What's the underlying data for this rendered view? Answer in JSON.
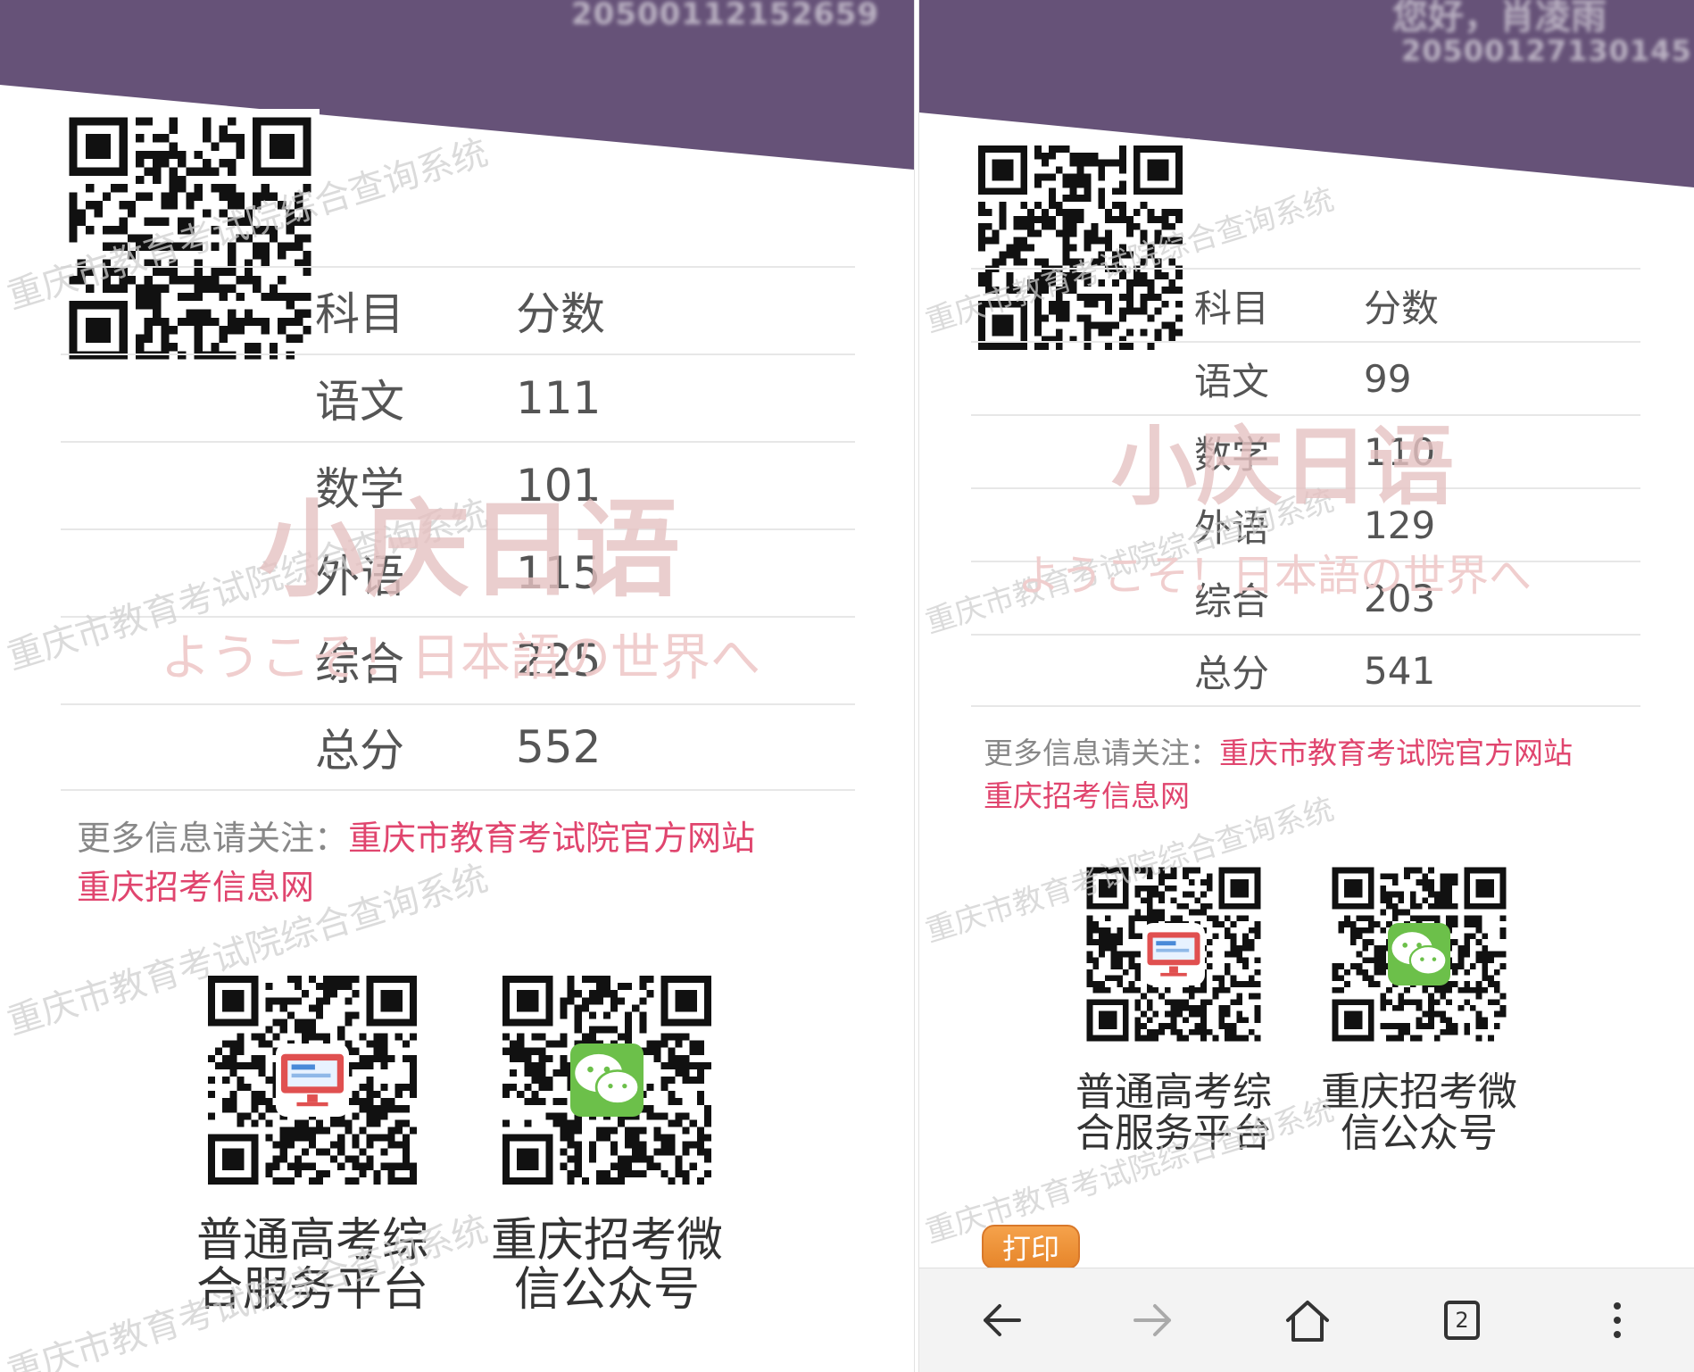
{
  "left": {
    "header_id": "20500112152659",
    "table": {
      "header": {
        "subject": "科目",
        "score": "分数"
      },
      "rows": [
        {
          "subject": "语文",
          "score": "111"
        },
        {
          "subject": "数学",
          "score": "101"
        },
        {
          "subject": "外语",
          "score": "115"
        },
        {
          "subject": "综合",
          "score": "225"
        },
        {
          "subject": "总分",
          "score": "552"
        }
      ]
    },
    "more_info": {
      "label": "更多信息请关注：",
      "link1": "重庆市教育考试院官方网站",
      "link2": "重庆招考信息网"
    },
    "services": [
      {
        "label": "普通高考综合服务平台"
      },
      {
        "label": "重庆招考微信公众号"
      }
    ],
    "watermarks": {
      "system": "重庆市教育考试院综合查询系统",
      "brand": "小庆日语",
      "brand_sub": "ようこそ！日本語の世界へ"
    }
  },
  "right": {
    "header_greeting": "您好，肖凌雨",
    "header_id": "20500127130145",
    "table": {
      "header": {
        "subject": "科目",
        "score": "分数"
      },
      "rows": [
        {
          "subject": "语文",
          "score": "99"
        },
        {
          "subject": "数学",
          "score": "110"
        },
        {
          "subject": "外语",
          "score": "129"
        },
        {
          "subject": "综合",
          "score": "203"
        },
        {
          "subject": "总分",
          "score": "541"
        }
      ]
    },
    "more_info": {
      "label": "更多信息请关注：",
      "link1": "重庆市教育考试院官方网站",
      "link2": "重庆招考信息网"
    },
    "services": [
      {
        "label": "普通高考综合服务平台"
      },
      {
        "label": "重庆招考微信公众号"
      }
    ],
    "print_label": "打印",
    "browser_bar": {
      "tab_count": "2",
      "icons": [
        "back-arrow-icon",
        "forward-arrow-icon",
        "home-icon",
        "tabs-icon",
        "more-vertical-icon"
      ]
    },
    "watermarks": {
      "system": "重庆市教育考试院综合查询系统",
      "brand": "小庆日语",
      "brand_sub": "ようこそ！日本語の世界へ"
    }
  },
  "colors": {
    "header": "#665278",
    "link": "#e0456e",
    "print_button": "#ee9437",
    "wechat_green": "#6cc04a"
  }
}
